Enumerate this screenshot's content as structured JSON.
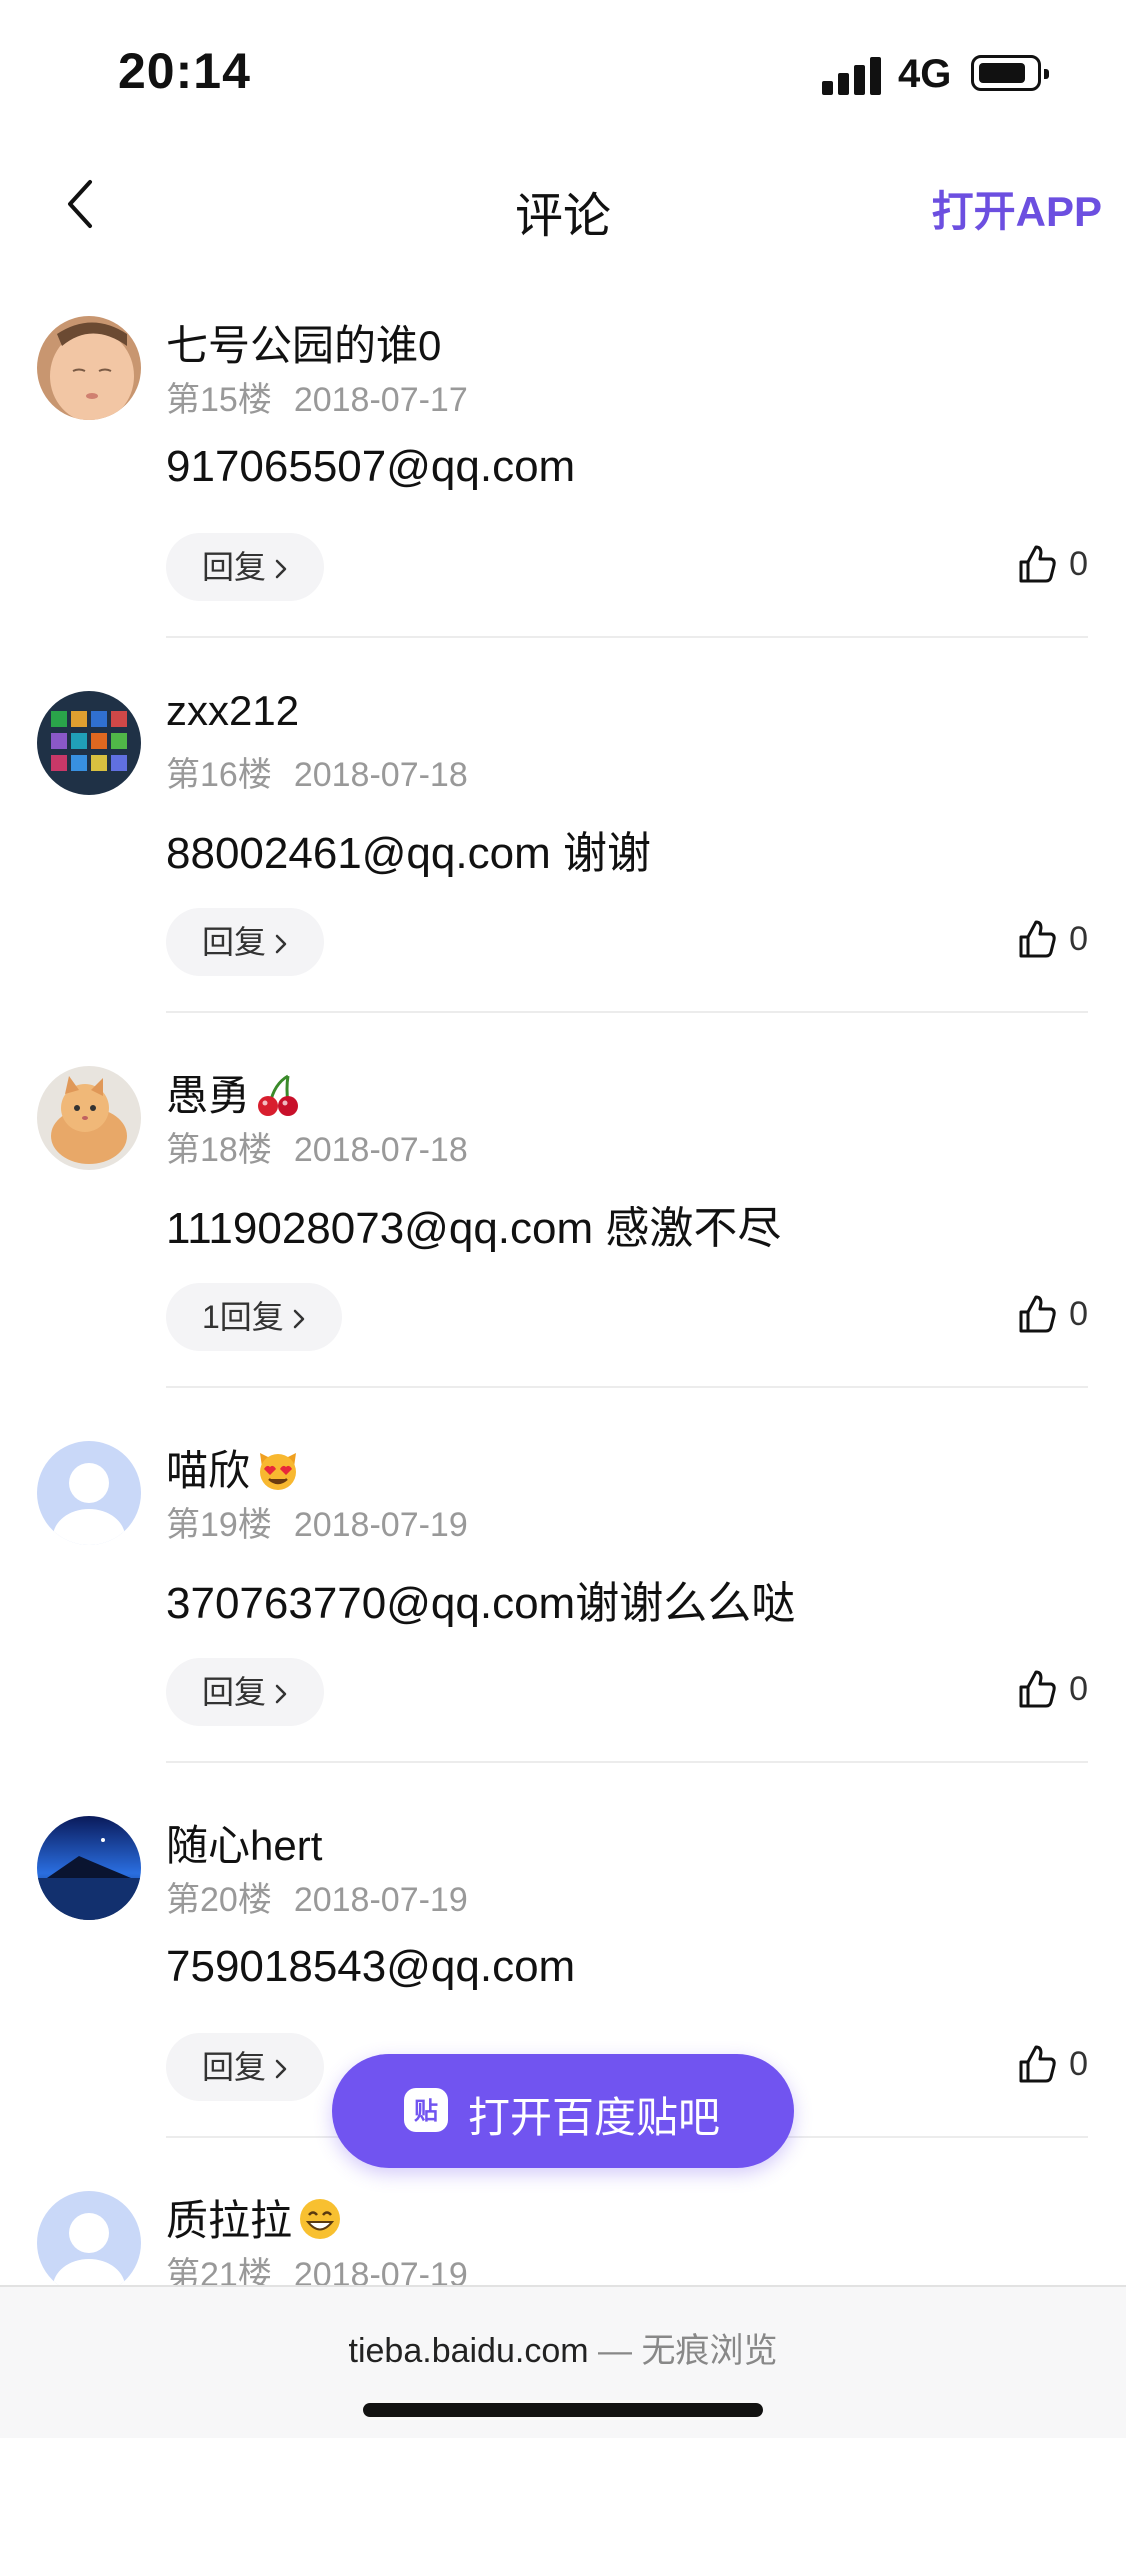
{
  "status_bar": {
    "time": "20:14",
    "network": "4G",
    "battery_level": 0.85
  },
  "nav": {
    "back_icon": "chevron-left-icon",
    "title": "评论",
    "open_app": "打开APP"
  },
  "comments": [
    {
      "username": "七号公园的谁0",
      "floor": "第15楼",
      "date": "2018-07-17",
      "content": "917065507@qq.com",
      "reply_label": "回复",
      "likes": "0",
      "avatar": "baby-photo"
    },
    {
      "username": "zxx212",
      "floor": "第16楼",
      "date": "2018-07-18",
      "content": "88002461@qq.com 谢谢",
      "reply_label": "回复",
      "likes": "0",
      "avatar": "app-grid-photo"
    },
    {
      "username": "愚勇",
      "floor": "第18楼",
      "date": "2018-07-18",
      "content": "1119028073@qq.com 感激不尽",
      "reply_label": "1回复",
      "likes": "0",
      "avatar": "cat-photo",
      "emoji": "cherries-emoji"
    },
    {
      "username": "喵欣",
      "floor": "第19楼",
      "date": "2018-07-19",
      "content": "370763770@qq.com谢谢么么哒",
      "reply_label": "回复",
      "likes": "0",
      "avatar": "default-avatar",
      "emoji": "heart-eyes-cat-emoji"
    },
    {
      "username": "随心hert",
      "floor": "第20楼",
      "date": "2018-07-19",
      "content": "759018543@qq.com",
      "reply_label": "回复",
      "likes": "0",
      "avatar": "mountain-photo"
    },
    {
      "username": "质拉拉",
      "floor": "第21楼",
      "date": "2018-07-19",
      "content": "",
      "reply_label": "",
      "likes": "",
      "avatar": "default-avatar",
      "emoji": "grinning-emoji"
    }
  ],
  "floating_button": {
    "label": "打开百度贴吧",
    "icon": "tieba-icon"
  },
  "bottom_bar": {
    "url": "tieba.baidu.com",
    "separator": "—",
    "mode": "无痕浏览"
  },
  "colors": {
    "accent": "#7154f0",
    "link": "#6c4fe0",
    "meta_text": "#999999"
  }
}
